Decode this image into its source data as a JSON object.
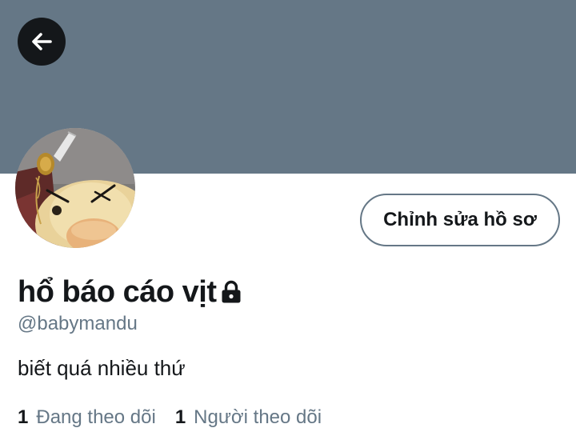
{
  "header": {
    "back_icon": "arrow-left-icon",
    "banner_color": "#657786"
  },
  "profile": {
    "display_name": "hổ báo cáo vịt",
    "protected_icon": "lock-icon",
    "handle": "@babymandu",
    "bio": "biết quá nhiều thứ",
    "edit_button_label": "Chỉnh sửa hồ sơ"
  },
  "stats": {
    "following_count": "1",
    "following_label": "Đang theo dõi",
    "followers_count": "1",
    "followers_label": "Người theo dõi"
  },
  "colors": {
    "text_primary": "#14171a",
    "text_secondary": "#657786",
    "button_border": "#657786",
    "back_button_bg": "#14171a"
  }
}
